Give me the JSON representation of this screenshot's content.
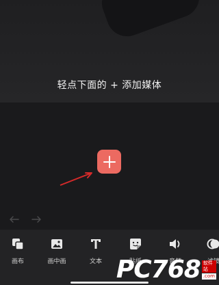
{
  "preview": {
    "hint": "轻点下面的 + 添加媒体"
  },
  "timeline": {
    "add_button_icon": "plus-icon",
    "accent_color": "#ec6a61"
  },
  "history": {
    "undo_icon": "undo-icon",
    "redo_icon": "redo-icon"
  },
  "toolbar": {
    "tools": [
      {
        "label": "画布",
        "icon": "canvas-icon"
      },
      {
        "label": "画中画",
        "icon": "picture-in-picture-icon"
      },
      {
        "label": "文本",
        "icon": "text-icon"
      },
      {
        "label": "贴纸",
        "icon": "sticker-icon"
      },
      {
        "label": "音频",
        "icon": "audio-icon"
      },
      {
        "label": "滤镜",
        "icon": "filter-icon"
      }
    ]
  },
  "watermark": {
    "brand": "PC768",
    "tag1": "软件站",
    "tag2": ".com"
  }
}
